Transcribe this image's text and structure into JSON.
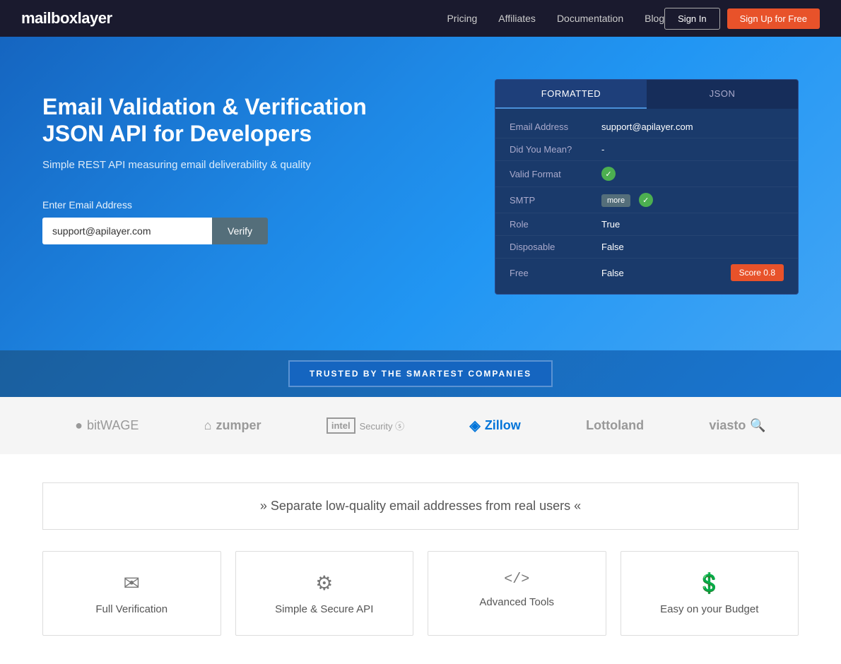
{
  "navbar": {
    "brand": "mailboxlayer",
    "links": [
      {
        "label": "Pricing",
        "href": "#"
      },
      {
        "label": "Affiliates",
        "href": "#"
      },
      {
        "label": "Documentation",
        "href": "#"
      },
      {
        "label": "Blog",
        "href": "#"
      }
    ],
    "signin_label": "Sign In",
    "signup_label": "Sign Up for Free"
  },
  "hero": {
    "title_line1": "Email Validation & Verification",
    "title_line2": "JSON API for Developers",
    "subtitle": "Simple REST API measuring email deliverability & quality",
    "input_label": "Enter Email Address",
    "input_placeholder": "support@apilayer.com",
    "input_value": "support@apilayer.com",
    "verify_button": "Verify"
  },
  "demo_card": {
    "tab_formatted": "FORMATTED",
    "tab_json": "JSON",
    "rows": [
      {
        "label": "Email Address",
        "value": "support@apilayer.com",
        "type": "text"
      },
      {
        "label": "Did You Mean?",
        "value": "-",
        "type": "text"
      },
      {
        "label": "Valid Format",
        "value": "",
        "type": "check"
      },
      {
        "label": "SMTP",
        "value": "",
        "type": "check-more"
      },
      {
        "label": "Role",
        "value": "True",
        "type": "text"
      },
      {
        "label": "Disposable",
        "value": "False",
        "type": "text"
      },
      {
        "label": "Free",
        "value": "False",
        "type": "text-score"
      }
    ],
    "more_label": "more",
    "score_label": "Score 0.8"
  },
  "trusted": {
    "badge_text": "TRUSTED BY THE SMARTEST COMPANIES"
  },
  "logos": [
    {
      "name": "bitwage",
      "prefix_icon": "●",
      "display": "bitWAGE"
    },
    {
      "name": "zumper",
      "prefix_icon": "⌂",
      "display": "zumper"
    },
    {
      "name": "intel_security",
      "prefix_icon": "",
      "display": "intel Security"
    },
    {
      "name": "zillow",
      "prefix_icon": "◈",
      "display": "Zillow"
    },
    {
      "name": "lottoland",
      "prefix_icon": "",
      "display": "Lottoland"
    },
    {
      "name": "viasto",
      "prefix_icon": "",
      "display": "viasto"
    }
  ],
  "features": {
    "banner_text": "» Separate low-quality email addresses from real users «",
    "cards": [
      {
        "icon": "✉",
        "title": "Full Verification"
      },
      {
        "icon": "⚙",
        "title": "Simple & Secure API"
      },
      {
        "icon": "</>",
        "title": "Advanced Tools"
      },
      {
        "icon": "$",
        "title": "Easy on your Budget"
      }
    ]
  }
}
